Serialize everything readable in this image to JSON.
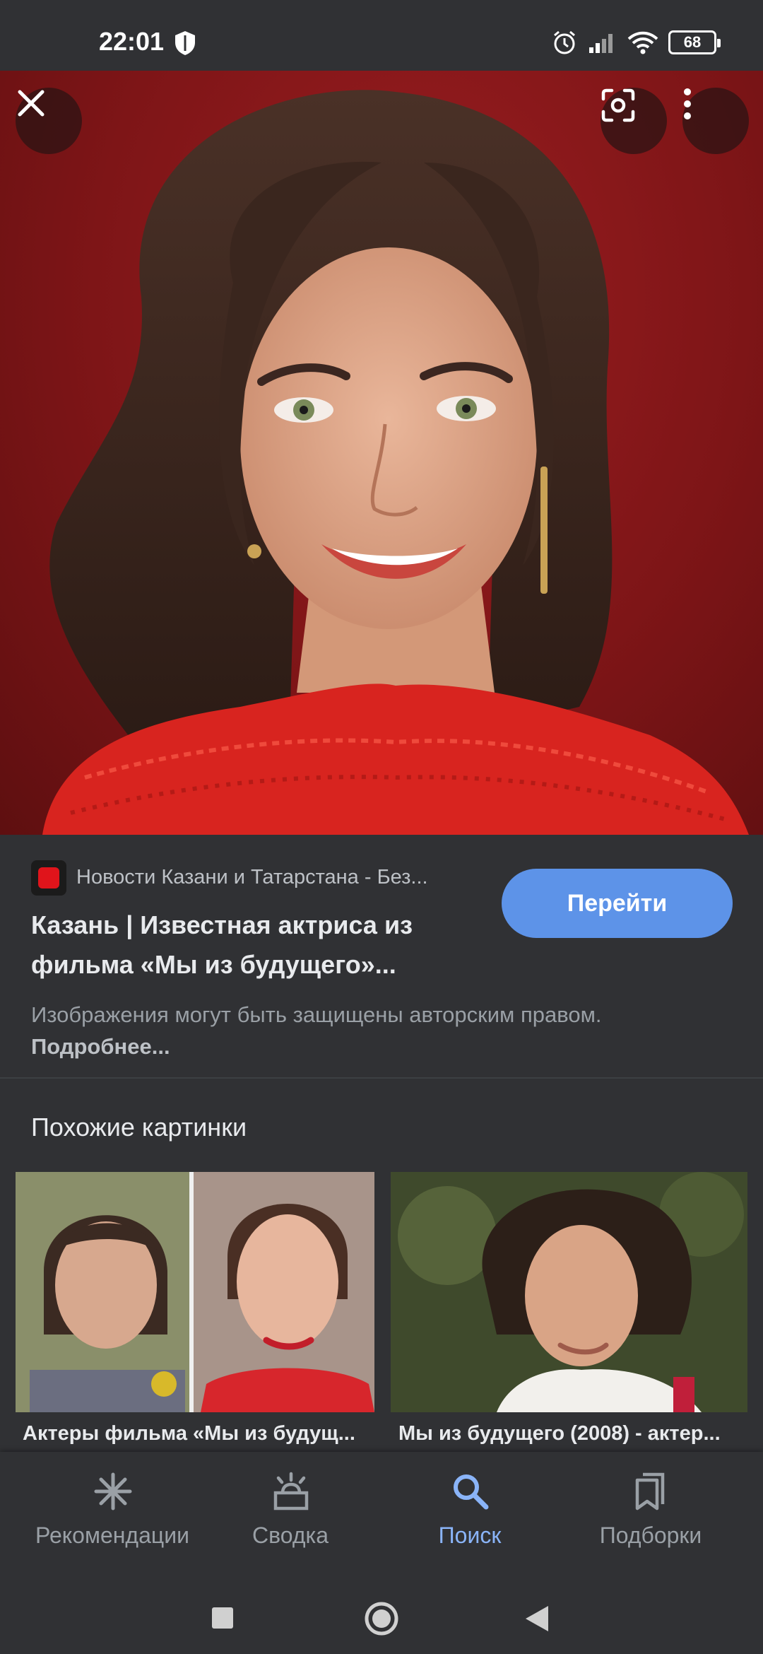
{
  "status_bar": {
    "time": "22:01",
    "battery": "68",
    "icons": [
      "shield-icon",
      "alarm-icon",
      "signal-icon",
      "wifi-icon",
      "battery-icon"
    ]
  },
  "hero": {
    "close_icon": "close-icon",
    "lens_icon": "google-lens-icon",
    "more_icon": "more-vert-icon"
  },
  "source": {
    "site_name": "Новости Казани и Татарстана - Без...",
    "title": "Казань | Известная актриса из фильма «Мы из будущего»...",
    "visit_label": "Перейти",
    "copyright_text": "Изображения могут быть защищены авторским правом.",
    "more_link": "Подробнее..."
  },
  "related": {
    "heading": "Похожие картинки",
    "items": [
      {
        "caption": "Актеры фильма «Мы из будущ..."
      },
      {
        "caption": "Мы из будущего (2008) - актер..."
      }
    ]
  },
  "bottom_nav": {
    "items": [
      {
        "label": "Рекомендации",
        "icon": "asterisk-icon"
      },
      {
        "label": "Сводка",
        "icon": "updates-icon"
      },
      {
        "label": "Поиск",
        "icon": "search-icon"
      },
      {
        "label": "Подборки",
        "icon": "collections-icon"
      }
    ],
    "active_index": 2
  },
  "colors": {
    "background": "#303134",
    "accent": "#8ab4f8",
    "button": "#5d93e8",
    "hero_red": "#8b1a1c"
  }
}
